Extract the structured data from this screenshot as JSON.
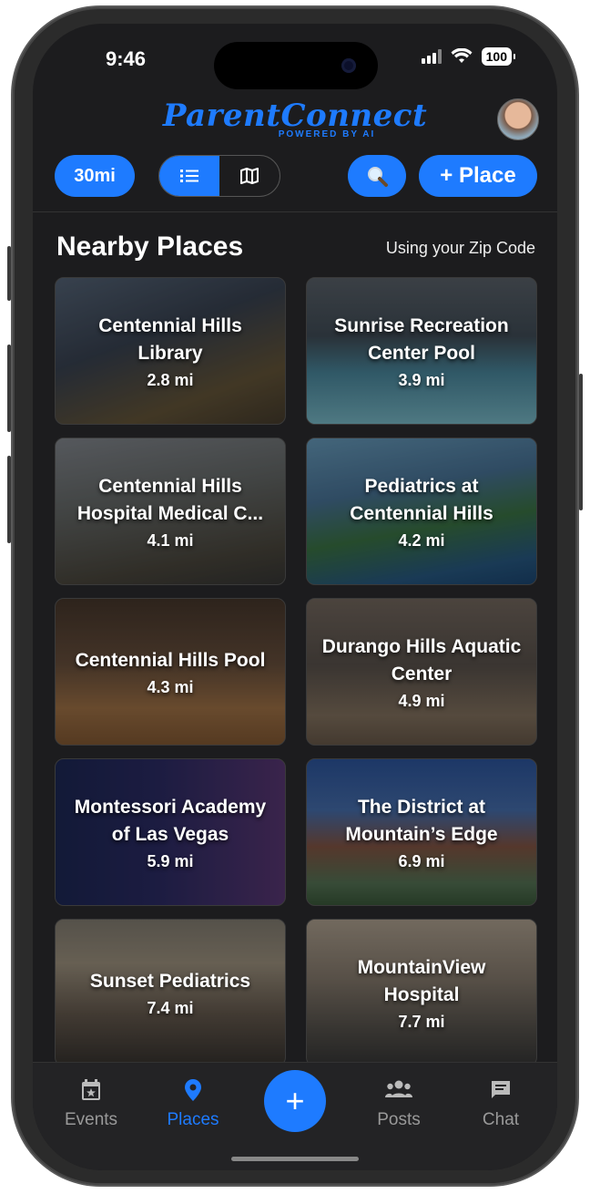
{
  "status": {
    "time": "9:46",
    "battery": "100"
  },
  "header": {
    "logo": "ParentConnect",
    "tagline": "POWERED BY AI"
  },
  "toolbar": {
    "radius_label": "30mi",
    "list_icon": "list-icon",
    "map_icon": "map-icon",
    "search_icon": "search-icon",
    "add_place_label": "+ Place"
  },
  "section": {
    "title": "Nearby Places",
    "subtitle": "Using your Zip Code"
  },
  "places": [
    {
      "name": "Centennial Hills Library",
      "distance": "2.8 mi",
      "bg": "linear-gradient(160deg,#5a6a7e 0%,#3c4656 40%,#6a5a3c 75%,#4a4030 100%)"
    },
    {
      "name": "Sunrise Recreation Center Pool",
      "distance": "3.9 mi",
      "bg": "linear-gradient(180deg,#5f6770 0%,#44515c 40%,#4e8fa6 65%,#7fc3d2 100%)"
    },
    {
      "name": "Centennial Hills Hospital Medical C...",
      "distance": "4.1 mi",
      "bg": "linear-gradient(170deg,#8a8f96 0%,#6b6f6e 40%,#4e4a40 80%,#3a3a38 100%)"
    },
    {
      "name": "Pediatrics at Centennial Hills",
      "distance": "4.2 mi",
      "bg": "linear-gradient(170deg,#6da4c6 0%,#4d7aa0 35%,#3e7a48 60%,#2a5e8a 85%,#1d4a78 100%)"
    },
    {
      "name": "Centennial Hills Pool",
      "distance": "4.3 mi",
      "bg": "linear-gradient(180deg,#4a3a2e 0%,#6e5440 45%,#a8784a 75%,#8a5e36 100%)"
    },
    {
      "name": "Durango Hills Aquatic Center",
      "distance": "4.9 mi",
      "bg": "linear-gradient(180deg,#7a6e64 0%,#5e5650 45%,#8a7864 80%,#6e5e4e 100%)"
    },
    {
      "name": "Montessori Academy of Las Vegas",
      "distance": "5.9 mi",
      "bg": "linear-gradient(90deg,#1e2a5a 0%,#2e2e6a 45%,#5e3a7a 100%)"
    },
    {
      "name": "The District at Mountain’s Edge",
      "distance": "6.9 mi",
      "bg": "linear-gradient(180deg,#2f5aa6 0%,#4a74b6 35%,#8a5a48 60%,#5a7a5a 85%,#3e5e3e 100%)"
    },
    {
      "name": "Sunset Pediatrics",
      "distance": "7.4 mi",
      "bg": "linear-gradient(180deg,#8a8478 0%,#a69a86 30%,#6a5e52 65%,#3a3632 100%)"
    },
    {
      "name": "MountainView Hospital",
      "distance": "7.7 mi",
      "bg": "linear-gradient(180deg,#b8aa98 0%,#8e8274 40%,#5a5650 75%,#3a3a3a 100%)"
    }
  ],
  "tabs": [
    {
      "label": "Events",
      "icon": "calendar-star-icon",
      "glyph": "▣"
    },
    {
      "label": "Places",
      "icon": "map-pin-icon",
      "glyph": "⬤"
    },
    {
      "label": "Posts",
      "icon": "group-icon",
      "glyph": "⚇"
    },
    {
      "label": "Chat",
      "icon": "chat-icon",
      "glyph": "▤"
    }
  ],
  "fab": {
    "label": "+"
  },
  "colors": {
    "accent": "#1e7bff",
    "background": "#1c1c1e"
  }
}
